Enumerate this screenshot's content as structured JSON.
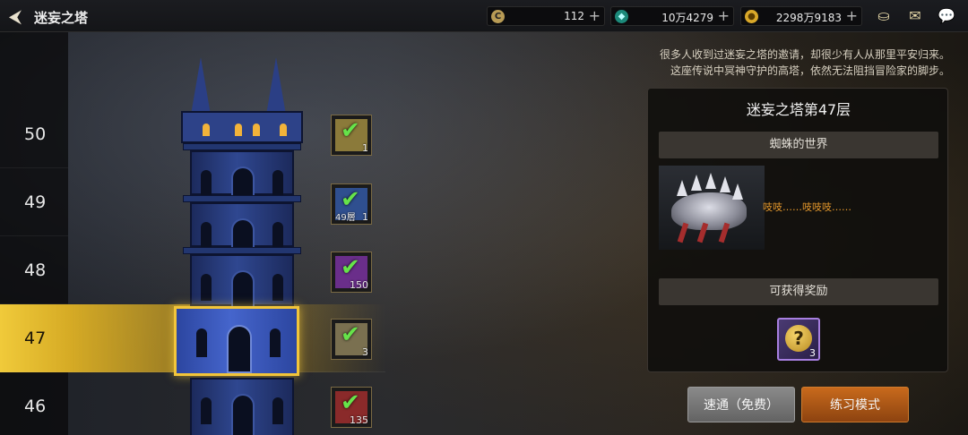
{
  "header": {
    "title": "迷妄之塔",
    "resources": [
      {
        "icon": "coin-c-icon",
        "value": "112"
      },
      {
        "icon": "green-gem-icon",
        "value": "10万4279"
      },
      {
        "icon": "gold-coin-icon",
        "value": "2298万9183"
      }
    ],
    "plus_label": "+",
    "icons": [
      "treasure-pot-icon",
      "mail-icon",
      "chat-icon"
    ]
  },
  "floors": [
    {
      "label": "50"
    },
    {
      "label": "49"
    },
    {
      "label": "48"
    },
    {
      "label": "47",
      "active": true
    },
    {
      "label": "46"
    }
  ],
  "tower_rewards": [
    {
      "floor": "50",
      "count": "1",
      "cleared": true,
      "color": "#8b7a3a"
    },
    {
      "floor": "49",
      "count": "1",
      "extra": "49層",
      "cleared": true,
      "color": "#2f4f8f"
    },
    {
      "floor": "48",
      "count": "150",
      "cleared": true,
      "color": "#6a2e8a"
    },
    {
      "floor": "47",
      "count": "3",
      "cleared": true,
      "color": "#7a7050"
    },
    {
      "floor": "46",
      "count": "135",
      "cleared": true,
      "color": "#8a2a2a"
    }
  ],
  "info": {
    "description_line1": "很多人收到过迷妄之塔的邀请，却很少有人从那里平安归来。",
    "description_line2": "这座传说中冥神守护的高塔，依然无法阻挡冒险家的脚步。",
    "panel_title": "迷妄之塔第47层",
    "stage_name": "蜘蛛的世界",
    "monster_speech": "吱吱……吱吱吱……",
    "reward_header": "可获得奖励",
    "reward_item": {
      "icon": "mystery-box-icon",
      "symbol": "?",
      "count": "3"
    }
  },
  "buttons": {
    "quick_clear": "速通（免费）",
    "practice": "练习模式"
  }
}
